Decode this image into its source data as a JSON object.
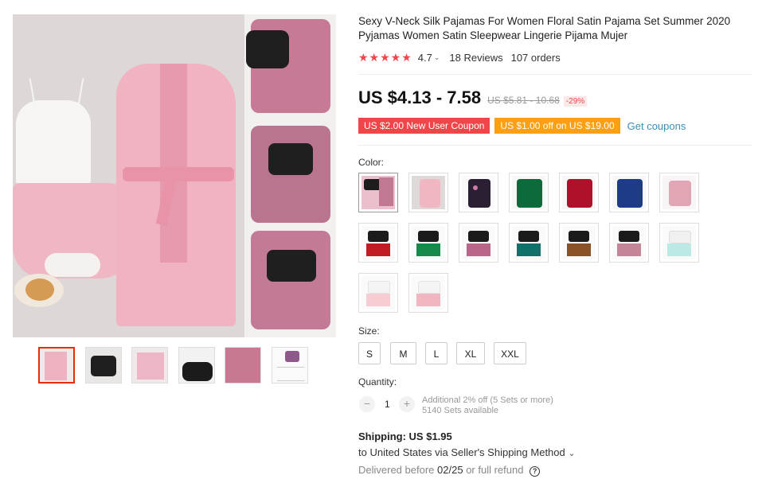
{
  "product": {
    "title": "Sexy V-Neck Silk Pajamas For Women Floral Satin Pajama Set Summer 2020 Pyjamas Women Satin Sleepwear Lingerie Pijama Mujer"
  },
  "rating": {
    "stars": "★★★★★",
    "value": "4.7",
    "reviews": "18 Reviews",
    "orders": "107 orders"
  },
  "price": {
    "current": "US $4.13 - 7.58",
    "original": "US $5.81 - 10.68",
    "discount": "-29%"
  },
  "coupons": {
    "new_user": "US $2.00 New User Coupon",
    "store": "US $1.00 off on US $19.00",
    "get_label": "Get coupons"
  },
  "color": {
    "label": "Color:"
  },
  "size": {
    "label": "Size:",
    "options": [
      "S",
      "M",
      "L",
      "XL",
      "XXL"
    ]
  },
  "quantity": {
    "label": "Quantity:",
    "minus": "−",
    "value": "1",
    "plus": "+",
    "additional": "Additional 2% off (5 Sets or more)",
    "available": "5140 Sets available"
  },
  "shipping": {
    "title": "Shipping: US $1.95",
    "to": "to United States via Seller's Shipping Method",
    "to_chevron": "⌄",
    "delivered_prefix": "Delivered before",
    "delivered_date": "02/25",
    "delivered_suffix": "or full refund",
    "help_icon": "?"
  },
  "colors": {
    "accent_red": "#e62e04",
    "coupon_red": "#f0464a",
    "coupon_orange": "#fba013",
    "link_blue": "#3a8fb7"
  }
}
